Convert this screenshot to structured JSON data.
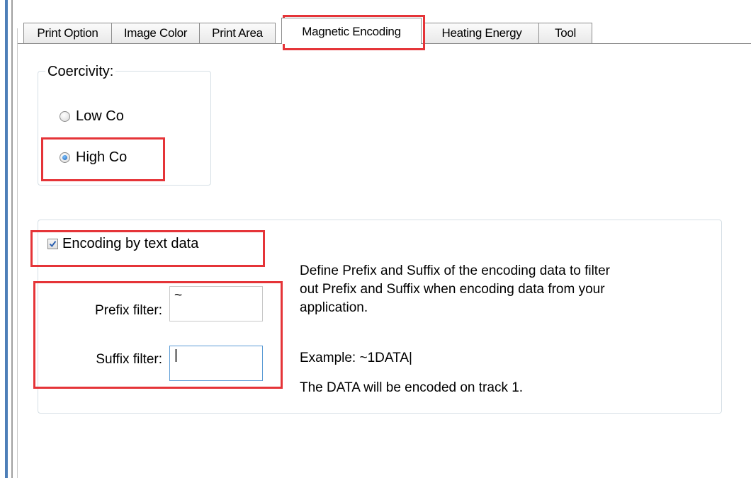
{
  "tabs": [
    {
      "label": "Print Option"
    },
    {
      "label": "Image Color"
    },
    {
      "label": "Print Area"
    },
    {
      "label": "Magnetic Encoding",
      "active": true
    },
    {
      "label": "Heating Energy"
    },
    {
      "label": "Tool"
    }
  ],
  "coercivity": {
    "legend": "Coercivity:",
    "options": [
      {
        "label": "Low Co",
        "selected": false
      },
      {
        "label": "High Co",
        "selected": true
      }
    ]
  },
  "encoding": {
    "checkbox_label": "Encoding by text data",
    "checked": true,
    "prefix_label": "Prefix filter:",
    "prefix_value": "~",
    "suffix_label": "Suffix filter:",
    "suffix_value": "|",
    "description_lines": [
      "Define Prefix and Suffix of the encoding data to filter",
      "out Prefix and Suffix when encoding data from your",
      "application."
    ],
    "example": "Example: ~1DATA|",
    "note": "The DATA will be encoded on track 1."
  },
  "colors": {
    "highlight": "#e53438",
    "radio_selected": "#1a5fb4",
    "focus_border": "#5b9bd5"
  }
}
